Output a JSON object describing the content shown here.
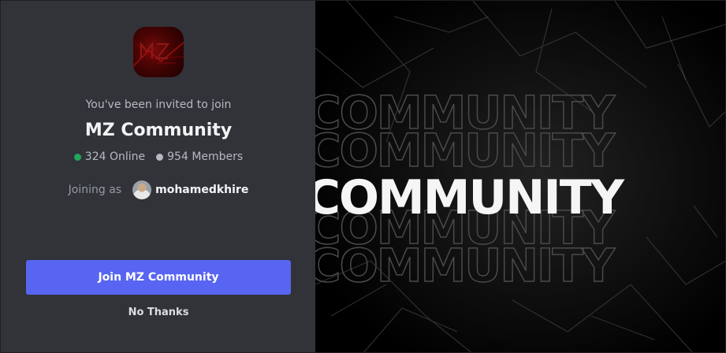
{
  "invite": {
    "intro": "You've been invited to join",
    "server_name": "MZ Community",
    "server_icon": "mz-logo-icon",
    "online_count": "324 Online",
    "member_count": "954 Members",
    "joining_label": "Joining as",
    "username": "mohamedkhire",
    "join_button": "Join MZ Community",
    "decline_button": "No Thanks"
  },
  "banner": {
    "word": "COMMUNITY"
  },
  "colors": {
    "online": "#23a55a",
    "members": "#b5bac1",
    "primary": "#5865f2",
    "panel": "#313338"
  }
}
